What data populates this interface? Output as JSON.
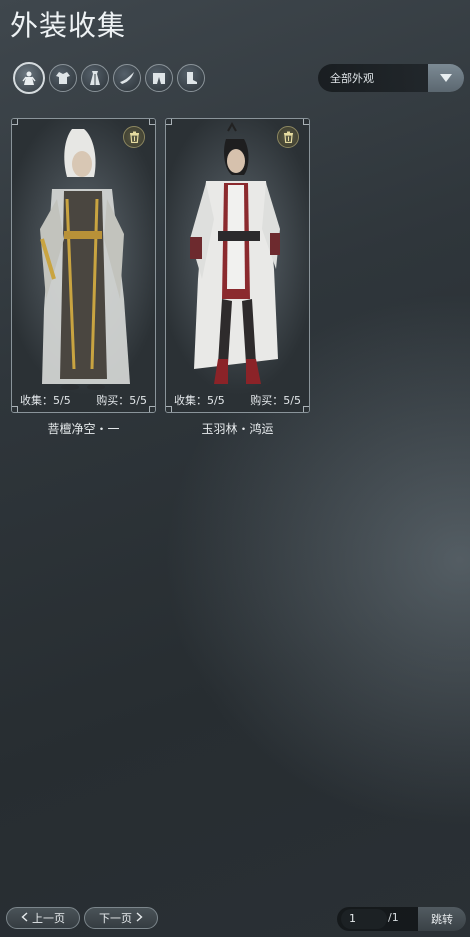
{
  "header": {
    "title": "外装收集"
  },
  "categories": [
    {
      "icon": "full-outfit-icon",
      "active": true
    },
    {
      "icon": "top-garment-icon",
      "active": false
    },
    {
      "icon": "robe-icon",
      "active": false
    },
    {
      "icon": "hat-icon",
      "active": false
    },
    {
      "icon": "pants-icon",
      "active": false
    },
    {
      "icon": "boots-icon",
      "active": false
    }
  ],
  "filter": {
    "selected": "全部外观"
  },
  "cards": [
    {
      "name": "菩檀净空・一",
      "collect_label": "收集：",
      "collect_value": "5/5",
      "buy_label": "购买：",
      "buy_value": "5/5"
    },
    {
      "name": "玉羽林・鸿运",
      "collect_label": "收集：",
      "collect_value": "5/5",
      "buy_label": "购买：",
      "buy_value": "5/5"
    }
  ],
  "pagination": {
    "prev_label": "上一页",
    "next_label": "下一页",
    "current_page": "1",
    "total": "/1",
    "jump_label": "跳转"
  },
  "colors": {
    "accent": "#8fa0ab",
    "card_border": "#8a949a",
    "trash": "#8c8760"
  }
}
